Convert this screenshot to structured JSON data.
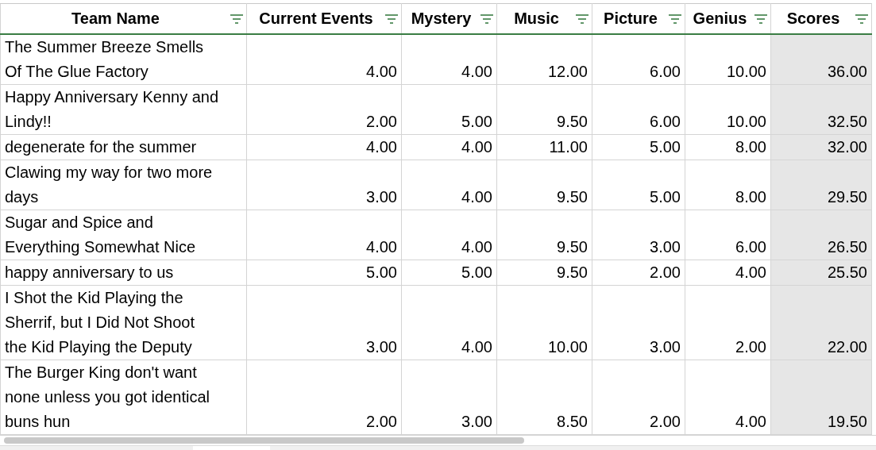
{
  "table": {
    "columns": [
      {
        "label": "Team Name",
        "filter": true
      },
      {
        "label": "Current Events",
        "filter": true
      },
      {
        "label": "Mystery",
        "filter": true
      },
      {
        "label": "Music",
        "filter": true
      },
      {
        "label": "Picture",
        "filter": true
      },
      {
        "label": "Genius",
        "filter": true
      },
      {
        "label": "Scores",
        "filter": true
      }
    ],
    "rows": [
      {
        "name": "The Summer Breeze Smells Of The Glue Factory",
        "values": [
          "4.00",
          "4.00",
          "12.00",
          "6.00",
          "10.00",
          "36.00"
        ]
      },
      {
        "name": "Happy Anniversary Kenny and Lindy!!",
        "values": [
          "2.00",
          "5.00",
          "9.50",
          "6.00",
          "10.00",
          "32.50"
        ]
      },
      {
        "name": "degenerate for the summer",
        "values": [
          "4.00",
          "4.00",
          "11.00",
          "5.00",
          "8.00",
          "32.00"
        ]
      },
      {
        "name": "Clawing my way for two more days",
        "values": [
          "3.00",
          "4.00",
          "9.50",
          "5.00",
          "8.00",
          "29.50"
        ]
      },
      {
        "name": "Sugar and Spice and Everything Somewhat Nice",
        "values": [
          "4.00",
          "4.00",
          "9.50",
          "3.00",
          "6.00",
          "26.50"
        ]
      },
      {
        "name": "happy anniversary to us",
        "values": [
          "5.00",
          "5.00",
          "9.50",
          "2.00",
          "4.00",
          "25.50"
        ]
      },
      {
        "name": "I Shot the Kid Playing the Sherrif, but I Did Not Shoot the Kid Playing the Deputy",
        "values": [
          "3.00",
          "4.00",
          "10.00",
          "3.00",
          "2.00",
          "22.00"
        ]
      },
      {
        "name": "The Burger King don't want none unless you got identical buns hun",
        "values": [
          "2.00",
          "3.00",
          "8.50",
          "2.00",
          "4.00",
          "19.50"
        ]
      }
    ]
  }
}
